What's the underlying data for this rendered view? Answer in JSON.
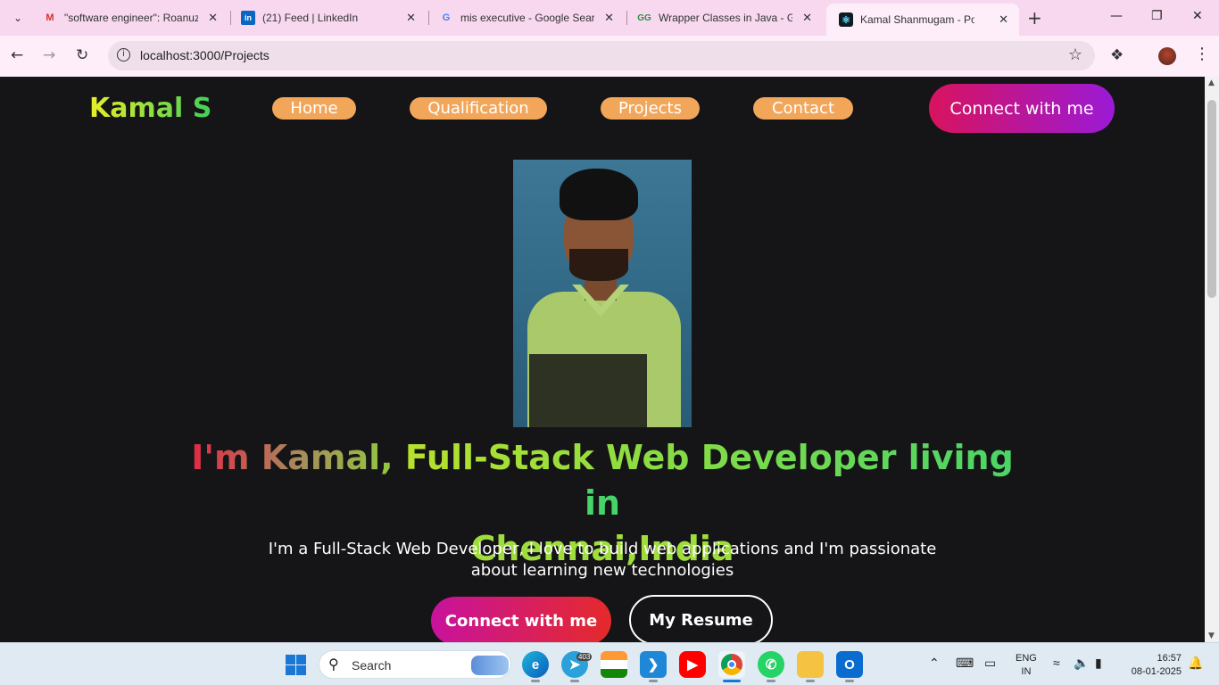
{
  "browser": {
    "tabs": [
      {
        "title": "\"software engineer\": Roanuz",
        "icon": "gmail-icon"
      },
      {
        "title": "(21) Feed | LinkedIn",
        "icon": "linkedin-icon"
      },
      {
        "title": "mis executive - Google Searc",
        "icon": "google-icon"
      },
      {
        "title": "Wrapper Classes in Java - Ge",
        "icon": "geeksforgeeks-icon"
      },
      {
        "title": "Kamal Shanmugam - Portfol",
        "icon": "react-icon"
      }
    ],
    "active_tab_index": 4,
    "url": "localhost:3000/Projects"
  },
  "page": {
    "brand": "Kamal S",
    "nav": [
      "Home",
      "Qualification",
      "Projects",
      "Contact"
    ],
    "connect_top": "Connect with me",
    "headline_line1_a": "I'm Kamal, ",
    "headline_line1_b": "Full-Stack Web Developer living in",
    "headline_line2": "Chennai,India",
    "subtitle": "I'm a Full-Stack Web Developer, I love to build web applications and I'm passionate about learning new technologies",
    "connect_main": "Connect with me",
    "resume": "My Resume"
  },
  "taskbar": {
    "search_placeholder": "Search",
    "telegram_badge": "403",
    "language": "ENG",
    "region": "IN",
    "time": "16:57",
    "date": "08-01-2025"
  },
  "colors": {
    "page_bg": "#151416",
    "nav_pill": "#f2a65a",
    "tabstrip": "#f7d8ef",
    "toolbar": "#fdeefa"
  }
}
